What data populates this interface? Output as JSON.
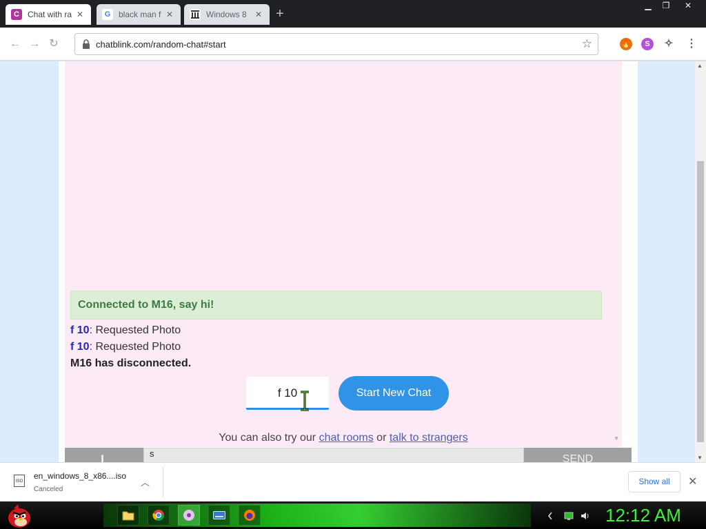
{
  "browser": {
    "tabs": [
      {
        "title": "Chat with ra",
        "favicon": "C",
        "favicon_color": "#b0369b",
        "active": true
      },
      {
        "title": "black man f",
        "favicon": "G",
        "favicon_color": "#4285f4",
        "active": false
      },
      {
        "title": "Windows 8",
        "favicon": "archive",
        "active": false
      }
    ],
    "url": "chatblink.com/random-chat#start"
  },
  "chat": {
    "status_banner": "Connected to M16, say hi!",
    "messages": [
      {
        "nick": "f 10",
        "text": ": Requested Photo"
      },
      {
        "nick": "f 10",
        "text": ": Requested Photo"
      }
    ],
    "disconnect_notice": "M16 has disconnected.",
    "nickname_value": "f 10",
    "start_button": "Start New Chat",
    "alt_prefix": "You can also try our",
    "alt_link_1": "chat rooms",
    "alt_or": "or",
    "alt_link_2": "talk to strangers",
    "message_input_value": "s",
    "send_button": "SEND"
  },
  "downloads": {
    "file_name": "en_windows_8_x86....iso",
    "status": "Canceled",
    "show_all": "Show all"
  },
  "taskbar": {
    "clock": "12:12 AM"
  }
}
